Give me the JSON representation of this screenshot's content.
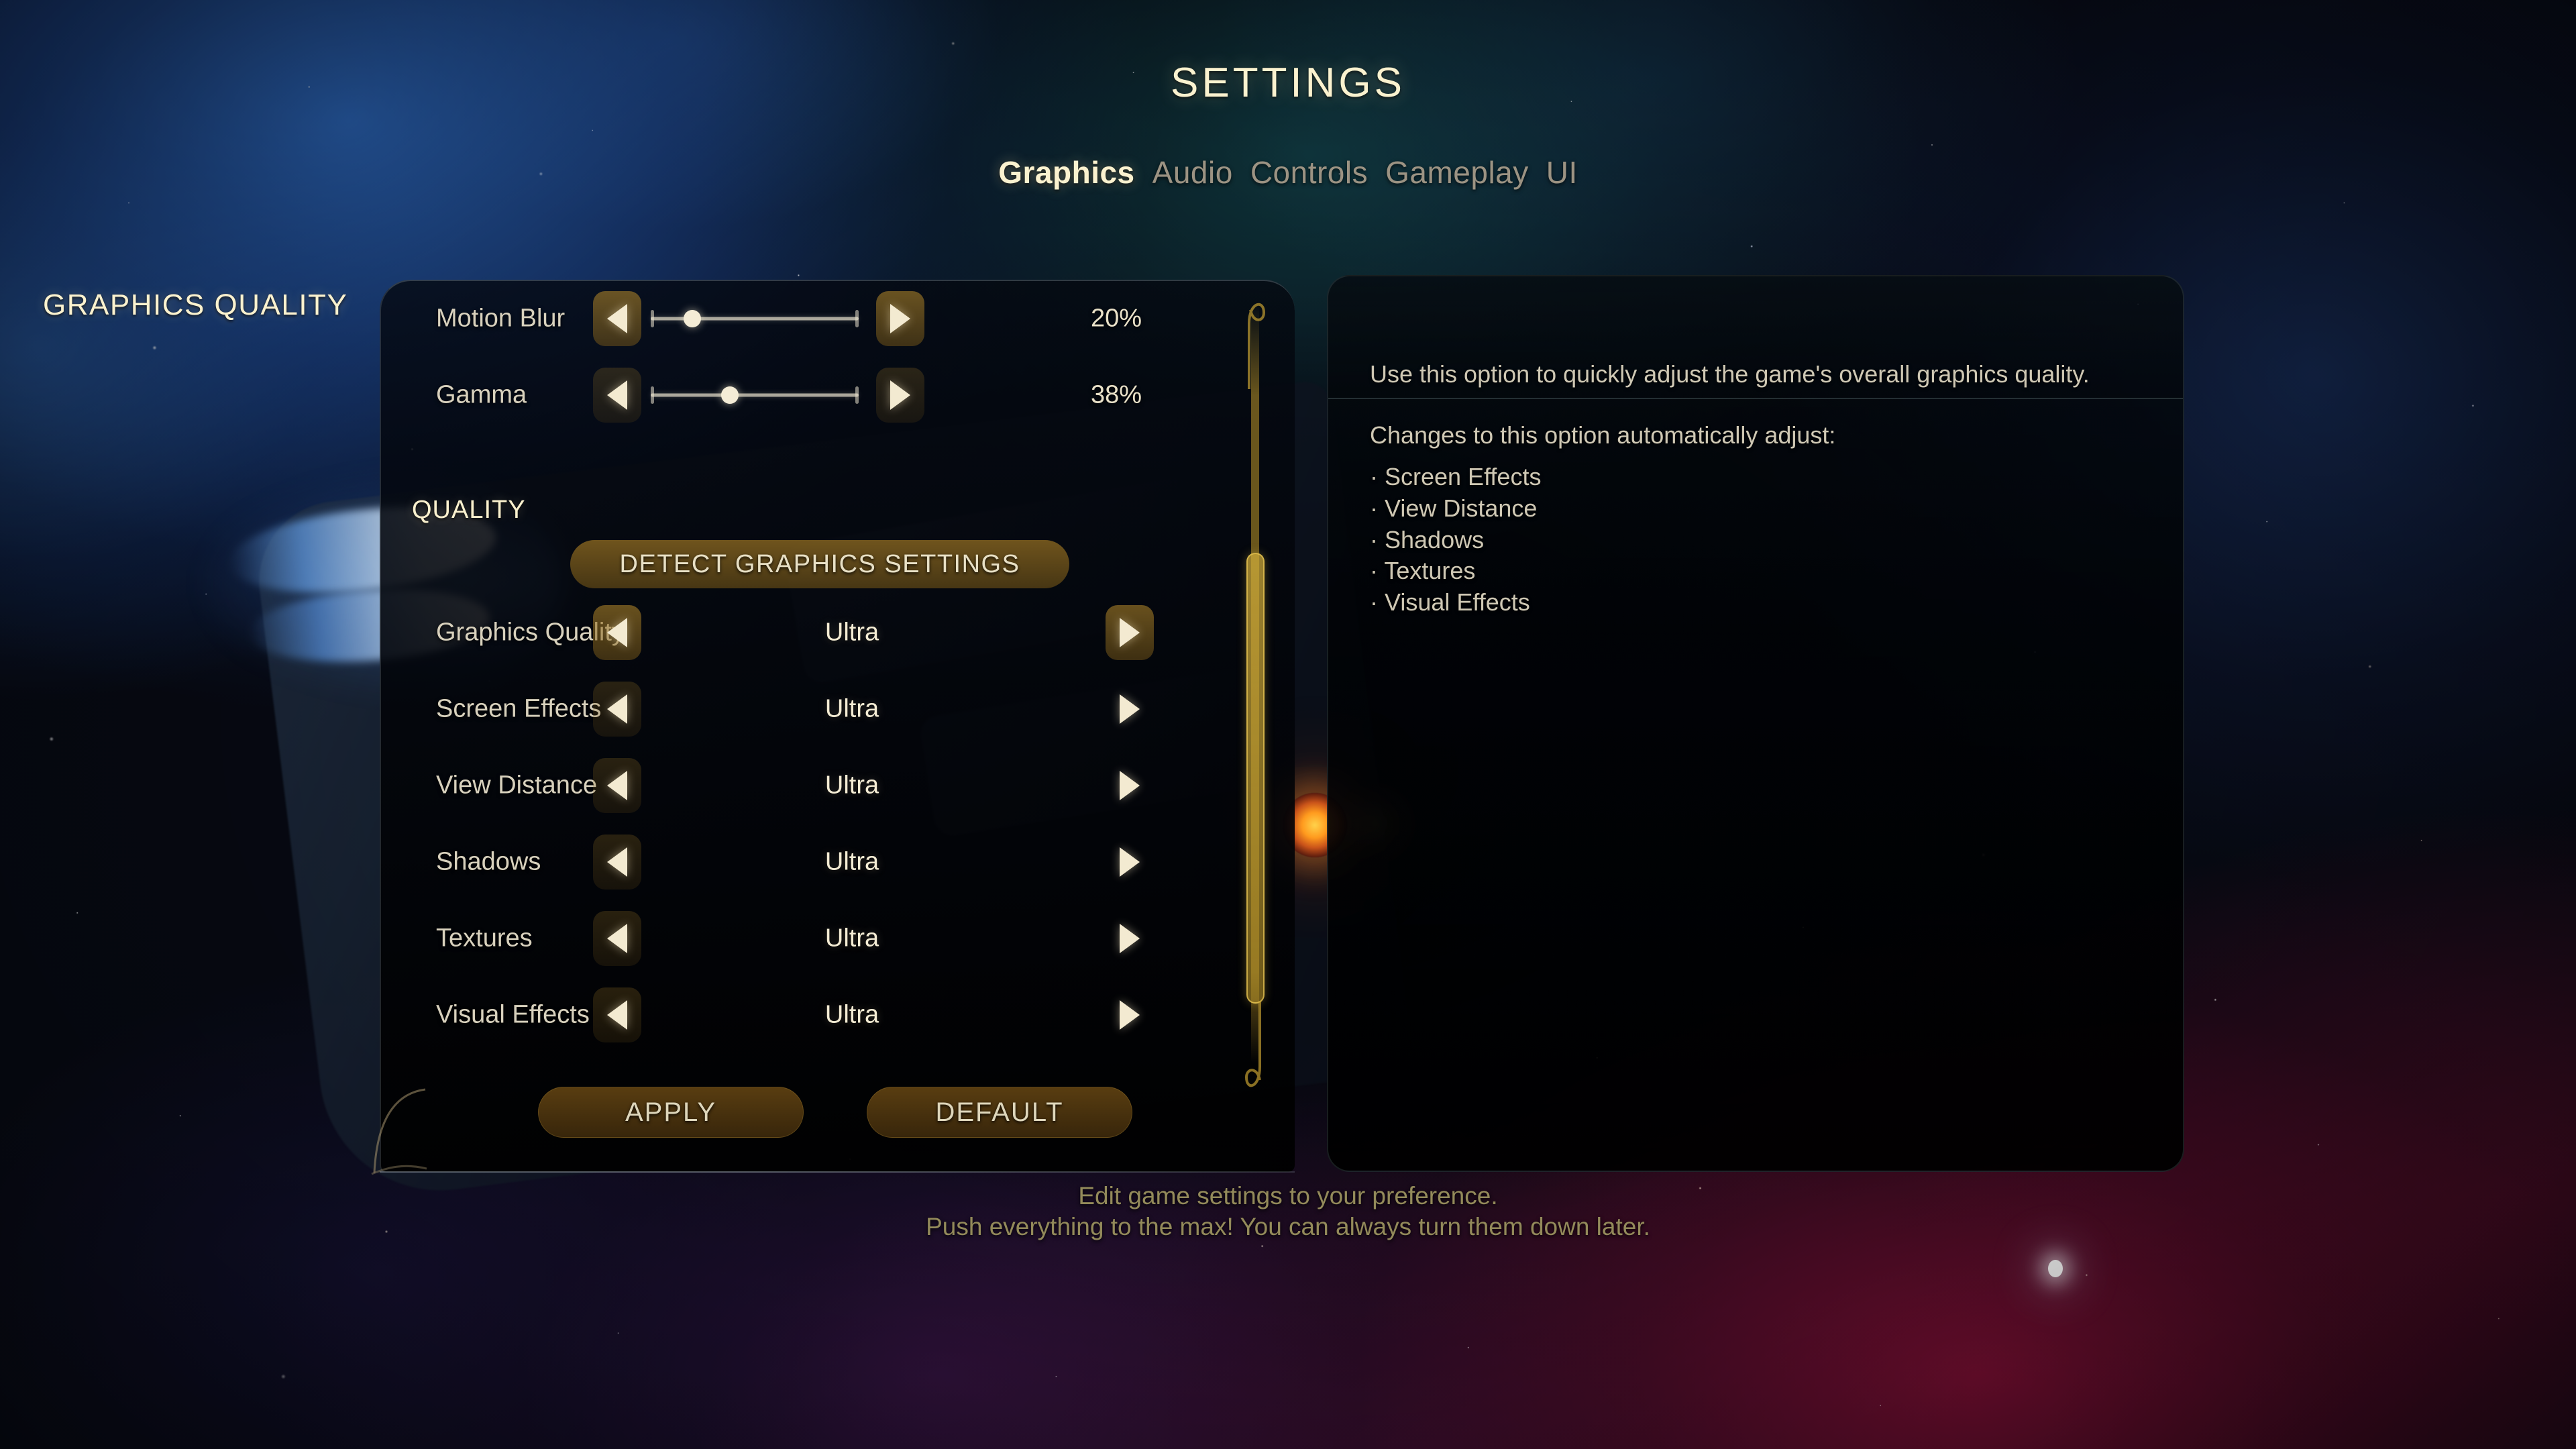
{
  "header": {
    "title": "SETTINGS",
    "tabs": [
      {
        "label": "Graphics",
        "active": true
      },
      {
        "label": "Audio",
        "active": false
      },
      {
        "label": "Controls",
        "active": false
      },
      {
        "label": "Gameplay",
        "active": false
      },
      {
        "label": "UI",
        "active": false
      }
    ]
  },
  "settings_panel": {
    "sliders": [
      {
        "label": "Motion Blur",
        "value": "20%",
        "percent": 20
      },
      {
        "label": "Gamma",
        "value": "38%",
        "percent": 38
      }
    ],
    "section_heading": "QUALITY",
    "detect_button": "DETECT GRAPHICS SETTINGS",
    "options": [
      {
        "label": "Graphics Quality",
        "value": "Ultra"
      },
      {
        "label": "Screen Effects",
        "value": "Ultra"
      },
      {
        "label": "View Distance",
        "value": "Ultra"
      },
      {
        "label": "Shadows",
        "value": "Ultra"
      },
      {
        "label": "Textures",
        "value": "Ultra"
      },
      {
        "label": "Visual Effects",
        "value": "Ultra"
      }
    ],
    "buttons": {
      "apply": "APPLY",
      "default": "DEFAULT"
    },
    "arrow_icons": {
      "decrease": "arrow-left-icon",
      "increase": "arrow-right-icon"
    }
  },
  "info_panel": {
    "title": "GRAPHICS QUALITY",
    "description": "Use this option to quickly adjust the game's overall graphics quality.",
    "subheading": "Changes to this option automatically adjust:",
    "bullets": [
      "· Screen Effects",
      "· View Distance",
      "· Shadows",
      "· Textures",
      "· Visual Effects"
    ]
  },
  "footer": {
    "line1": "Edit game settings to your preference.",
    "line2": "Push everything to the max! You can always turn them down later."
  },
  "colors": {
    "accent_gold": "#fbf2cf",
    "text_primary": "#d8d1bd",
    "text_muted": "#9c9383",
    "button_amber": "#60421299",
    "scrollbar": "#d4b03c",
    "footer_text": "#938a5a"
  }
}
